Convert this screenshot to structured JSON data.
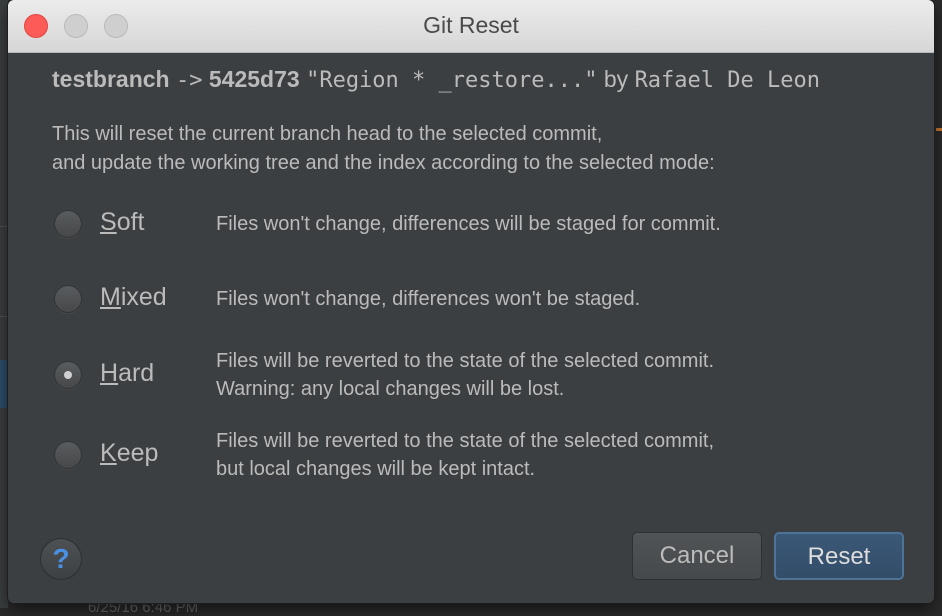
{
  "window": {
    "title": "Git Reset"
  },
  "header": {
    "branch": "testbranch",
    "arrow": "->",
    "commit": "5425d73",
    "message": "\"Region * _restore...\"",
    "by": "by",
    "author": "Rafael De Leon"
  },
  "description": {
    "line1": "This will reset the current branch head to the selected commit,",
    "line2": "and update the working tree and the index according to the selected mode:"
  },
  "options": [
    {
      "mnemonic": "S",
      "rest": "oft",
      "checked": false,
      "desc1": "Files won't change, differences will be staged for commit.",
      "desc2": ""
    },
    {
      "mnemonic": "M",
      "rest": "ixed",
      "checked": false,
      "desc1": "Files won't change, differences won't be staged.",
      "desc2": ""
    },
    {
      "mnemonic": "H",
      "rest": "ard",
      "checked": true,
      "desc1": "Files will be reverted to the state of the selected commit.",
      "desc2": "Warning: any local changes will be lost."
    },
    {
      "mnemonic": "K",
      "rest": "eep",
      "checked": false,
      "desc1": "Files will be reverted to the state of the selected commit,",
      "desc2": "but local changes will be kept intact."
    }
  ],
  "buttons": {
    "help": "?",
    "cancel": "Cancel",
    "reset": "Reset"
  },
  "background": {
    "bottom_text": "6/25/16 6:46 PM"
  },
  "colors": {
    "accent": "#4a90e2",
    "close": "#fc5b57",
    "dialog_bg": "#3c3f41"
  },
  "icons": {
    "help": "question-icon"
  }
}
